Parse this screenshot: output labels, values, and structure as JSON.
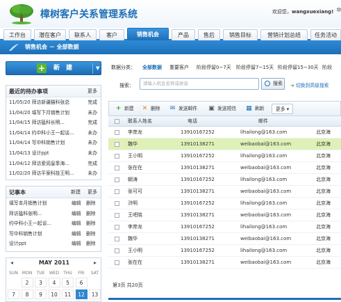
{
  "header": {
    "title": "樟树客户关系管理系统",
    "welcome_prefix": "欢迎您，",
    "username": "wangxuexiang!"
  },
  "tabs": [
    "工作台",
    "潜在客户",
    "联系人",
    "客户",
    "销售机会",
    "产品",
    "售后",
    "销售目标",
    "营销计划总结",
    "任务活动"
  ],
  "active_tab_index": 4,
  "breadcrumb": "销售机会 － 全部数据",
  "new_button": {
    "label": "新　建"
  },
  "todo": {
    "title": "最近的待办事项",
    "more": "更多",
    "items": [
      {
        "date": "11/05/20",
        "text": "拜访新疆猫科张总",
        "status": "完成"
      },
      {
        "date": "11/04/20",
        "text": "填写下月销售计划",
        "status": "未办"
      },
      {
        "date": "11/04/15",
        "text": "拜访猛科长明...",
        "status": "完成"
      },
      {
        "date": "11/04/14",
        "text": "约中科小王一起谈...",
        "status": "未办"
      },
      {
        "date": "11/04/14",
        "text": "写中科销售计划",
        "status": "未办"
      },
      {
        "date": "11/04/13",
        "text": "设计ppt",
        "status": "未办"
      },
      {
        "date": "11/04/12",
        "text": "拜访爱阅皇季海...",
        "status": "完成"
      },
      {
        "date": "11/02/20",
        "text": "拜访平案科技王明...",
        "status": "未办"
      }
    ]
  },
  "memo": {
    "title": "记事本",
    "new_label": "新建",
    "more": "更多",
    "edit_label": "编辑",
    "delete_label": "删除",
    "items": [
      "填写本月销售计划",
      "拜访猛科张明...",
      "约中科小王一起谈...",
      "写中科销售计划",
      "设计ppt"
    ]
  },
  "calendar": {
    "month_label": "MAY 2011",
    "prev": "◂",
    "next": "▸",
    "weekdays": [
      "SUN",
      "MON",
      "TUE",
      "WED",
      "THU",
      "FRI",
      "SAT"
    ],
    "week1": [
      "",
      "2",
      "3",
      "4",
      "5",
      "6",
      ""
    ],
    "week2": [
      "7",
      "8",
      "9",
      "10",
      "11",
      "12",
      "13"
    ],
    "selected_day": "12"
  },
  "filter": {
    "label": "数据分类：",
    "options": [
      "全部数据",
      "重要客户",
      "阶段停留0~7天",
      "阶段停留7~15天",
      "阶段停留15~30天",
      "阶段"
    ],
    "active_index": 0
  },
  "search": {
    "label": "搜索：",
    "placeholder": "请输入机会名称或拼音",
    "button": "搜索",
    "advanced": "切换到高级搜索"
  },
  "toolbar": {
    "new": "新建",
    "delete": "删除",
    "send_email": "发送邮件",
    "send_sms": "发送短信",
    "refresh": "刷新",
    "more": "更多 ▾"
  },
  "grid": {
    "columns": [
      "联系人姓名",
      "电话",
      "邮件"
    ],
    "rows": [
      {
        "name": "李岸龙",
        "phone": "13910167252",
        "email": "lihailong@163.com",
        "extra": "北京海"
      },
      {
        "name": "魏华",
        "phone": "13910138271",
        "email": "weibaobai@163.com",
        "extra": "北京海"
      },
      {
        "name": "王小明",
        "phone": "13910167252",
        "email": "lihailong@163.com",
        "extra": "北京海"
      },
      {
        "name": "张在在",
        "phone": "13910138271",
        "email": "weibaobai@163.com",
        "extra": "北京海"
      },
      {
        "name": "朝涛",
        "phone": "13910167252",
        "email": "lihailong@163.com",
        "extra": "北京海"
      },
      {
        "name": "张可可",
        "phone": "13910138271",
        "email": "weibaobai@163.com",
        "extra": "北京海"
      },
      {
        "name": "浒明",
        "phone": "13910167252",
        "email": "lihailong@163.com",
        "extra": "北京海"
      },
      {
        "name": "王吧晓",
        "phone": "13910138271",
        "email": "weibaobai@163.com",
        "extra": "北京海"
      },
      {
        "name": "李岸龙",
        "phone": "13910167252",
        "email": "lihailong@163.com",
        "extra": "北京海"
      },
      {
        "name": "魏华",
        "phone": "13910138271",
        "email": "weibaobai@163.com",
        "extra": "北京海"
      },
      {
        "name": "王小明",
        "phone": "13910167252",
        "email": "lihailong@163.com",
        "extra": "北京海"
      },
      {
        "name": "张在在",
        "phone": "13910138271",
        "email": "weibaobai@163.com",
        "extra": "北京海"
      }
    ],
    "highlighted_row": 1
  },
  "pager": "第3页 共20页",
  "colors": {
    "brand": "#1d6fb8",
    "new_green": "#5cb531",
    "row_highlight": "#dff1b7"
  }
}
